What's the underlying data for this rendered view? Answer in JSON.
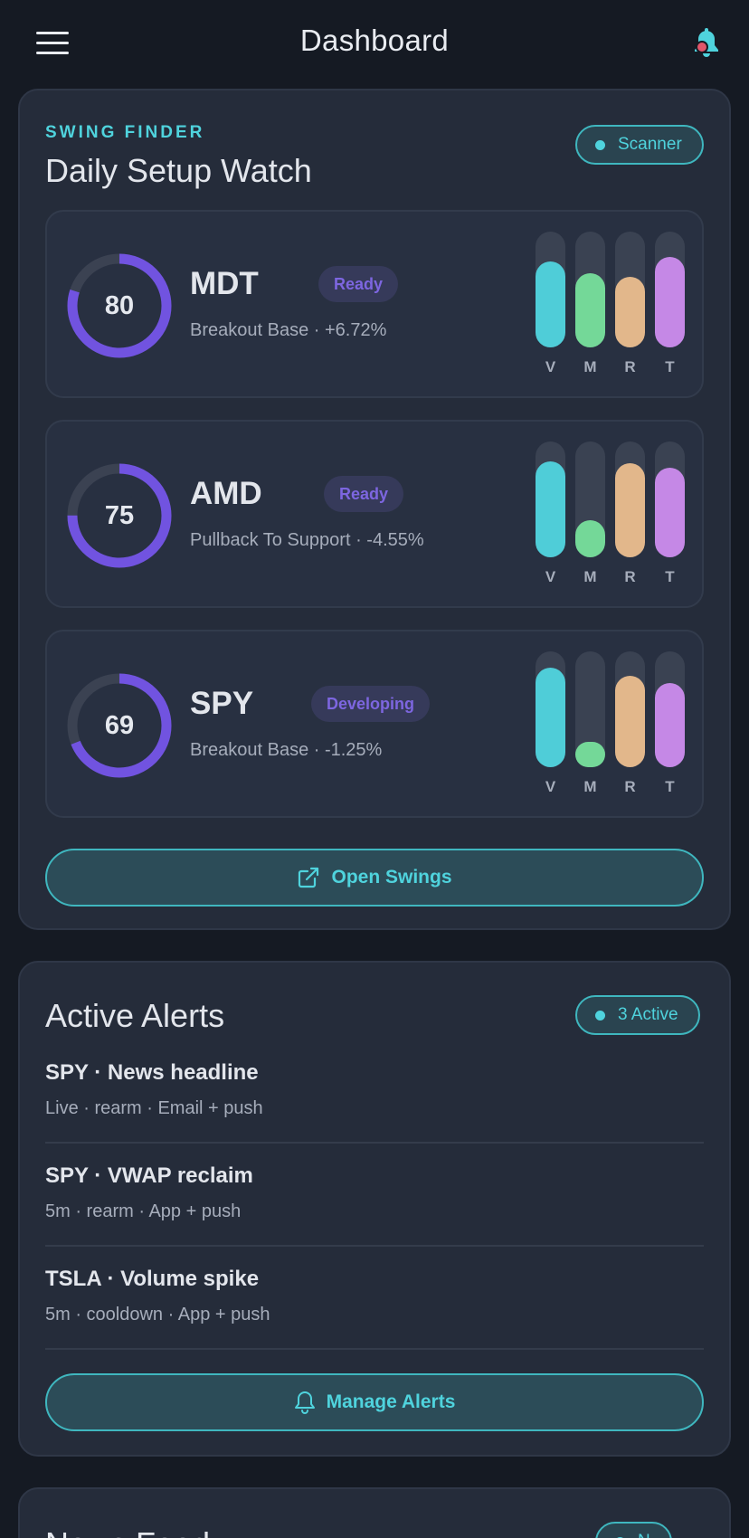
{
  "header": {
    "title": "Dashboard",
    "menu_icon": "hamburger-menu-icon",
    "bell_icon": "notification-bell-icon"
  },
  "swing_finder": {
    "eyebrow": "SWING FINDER",
    "title": "Daily Setup Watch",
    "badge_label": "Scanner",
    "setups": [
      {
        "score": "80",
        "score_fraction": 0.8,
        "ticker": "MDT",
        "status": "Ready",
        "subtitle": "Breakout Base · +6.72%",
        "bars": [
          {
            "label": "V",
            "level": 0.74,
            "color": "#4fcdd8"
          },
          {
            "label": "M",
            "level": 0.64,
            "color": "#74d898"
          },
          {
            "label": "R",
            "level": 0.61,
            "color": "#e2b78b"
          },
          {
            "label": "T",
            "level": 0.78,
            "color": "#c588e6"
          }
        ]
      },
      {
        "score": "75",
        "score_fraction": 0.75,
        "ticker": "AMD",
        "status": "Ready",
        "subtitle": "Pullback To Support · -4.55%",
        "bars": [
          {
            "label": "V",
            "level": 0.83,
            "color": "#4fcdd8"
          },
          {
            "label": "M",
            "level": 0.32,
            "color": "#74d898"
          },
          {
            "label": "R",
            "level": 0.81,
            "color": "#e2b78b"
          },
          {
            "label": "T",
            "level": 0.77,
            "color": "#c588e6"
          }
        ]
      },
      {
        "score": "69",
        "score_fraction": 0.69,
        "ticker": "SPY",
        "status": "Developing",
        "subtitle": "Breakout Base · -1.25%",
        "bars": [
          {
            "label": "V",
            "level": 0.86,
            "color": "#4fcdd8"
          },
          {
            "label": "M",
            "level": 0.22,
            "color": "#74d898"
          },
          {
            "label": "R",
            "level": 0.79,
            "color": "#e2b78b"
          },
          {
            "label": "T",
            "level": 0.73,
            "color": "#c588e6"
          }
        ]
      }
    ],
    "open_button": "Open Swings",
    "open_icon": "external-link-icon"
  },
  "alerts": {
    "title": "Active Alerts",
    "badge_label": "3 Active",
    "items": [
      {
        "title": "SPY · News headline",
        "subtitle": "Live · rearm · Email + push"
      },
      {
        "title": "SPY · VWAP reclaim",
        "subtitle": "5m · rearm · App + push"
      },
      {
        "title": "TSLA · Volume spike",
        "subtitle": "5m · cooldown · App + push"
      }
    ],
    "manage_button": "Manage Alerts",
    "manage_icon": "bell-icon"
  },
  "news": {
    "title": "News Feed",
    "badge_label": "N"
  },
  "colors": {
    "accent": "#4fd3dd",
    "ring": "#7153e0",
    "ring_track": "#3b4252",
    "background": "#151a23",
    "card": "#252c3a"
  }
}
